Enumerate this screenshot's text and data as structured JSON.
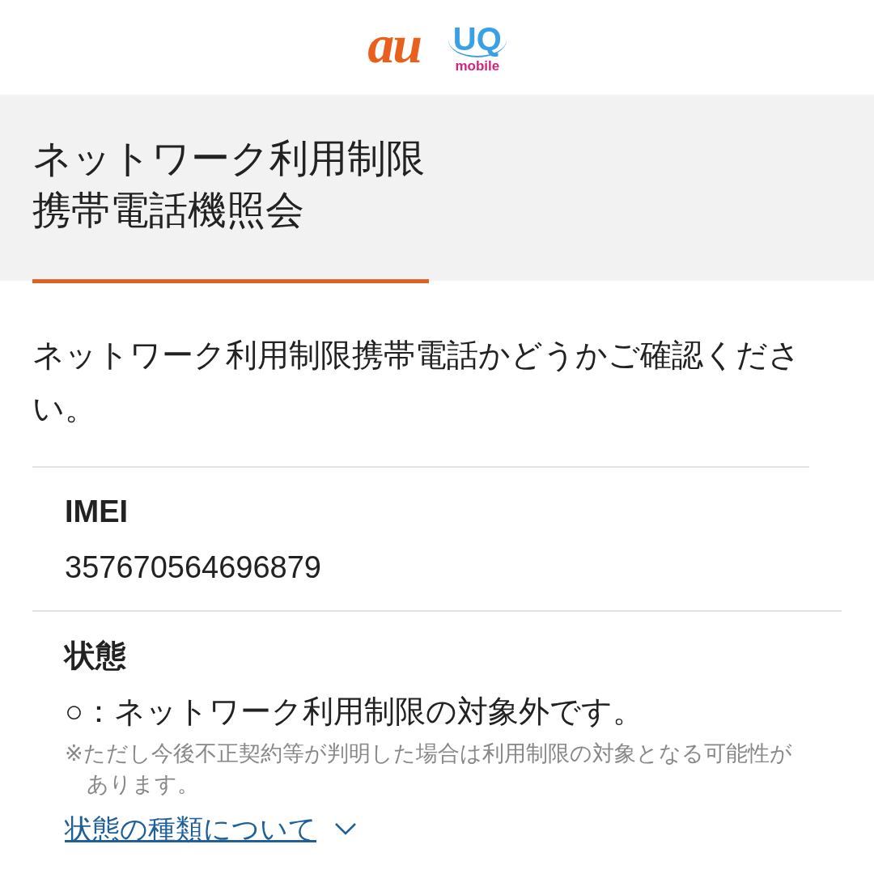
{
  "header": {
    "logo_au": "au",
    "logo_uq": "UQ",
    "logo_uq_sub": "mobile"
  },
  "title": {
    "lines": [
      "ネットワーク利用制限",
      "携帯電話機照会"
    ]
  },
  "intro": "ネットワーク利用制限携帯電話かどうかご確認ください。",
  "fields": [
    {
      "label": "IMEI",
      "value": "357670564696879"
    },
    {
      "label": "状態",
      "value": "○：ネットワーク利用制限の対象外です。",
      "note": "※ただし今後不正契約等が判明した場合は利用制限の対象となる可能性があります。"
    }
  ],
  "link": {
    "label": "状態の種類について",
    "expanded": false
  }
}
